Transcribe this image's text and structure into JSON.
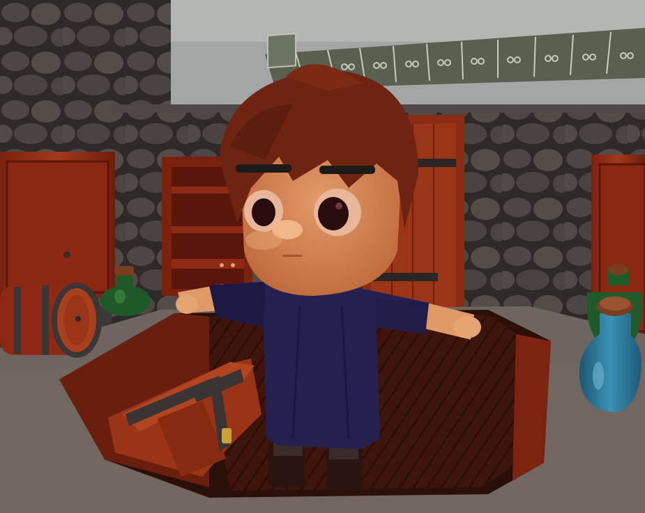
{
  "scene": {
    "description_visible_text": "",
    "palette": {
      "sky": "#9fa3a1",
      "stone_dark": "#3f3a38",
      "stone_light": "#5a5350",
      "wood_red": "#8e2a14",
      "wood_floor": "#4a1a10",
      "counter": "#6f6560",
      "robe": "#26204f",
      "skin": "#d98a5a",
      "hair": "#6e2412",
      "green_bottle": "#1f5a2a",
      "blue_bottle": "#2e7a9a",
      "cork": "#7a3e1e",
      "banner": "#5c6356"
    },
    "icons": [
      "barrel-icon",
      "chest-icon",
      "green-bottle-icon",
      "blue-bottle-icon",
      "door-icon",
      "shelf-icon",
      "banner-icon",
      "character-icon"
    ]
  }
}
